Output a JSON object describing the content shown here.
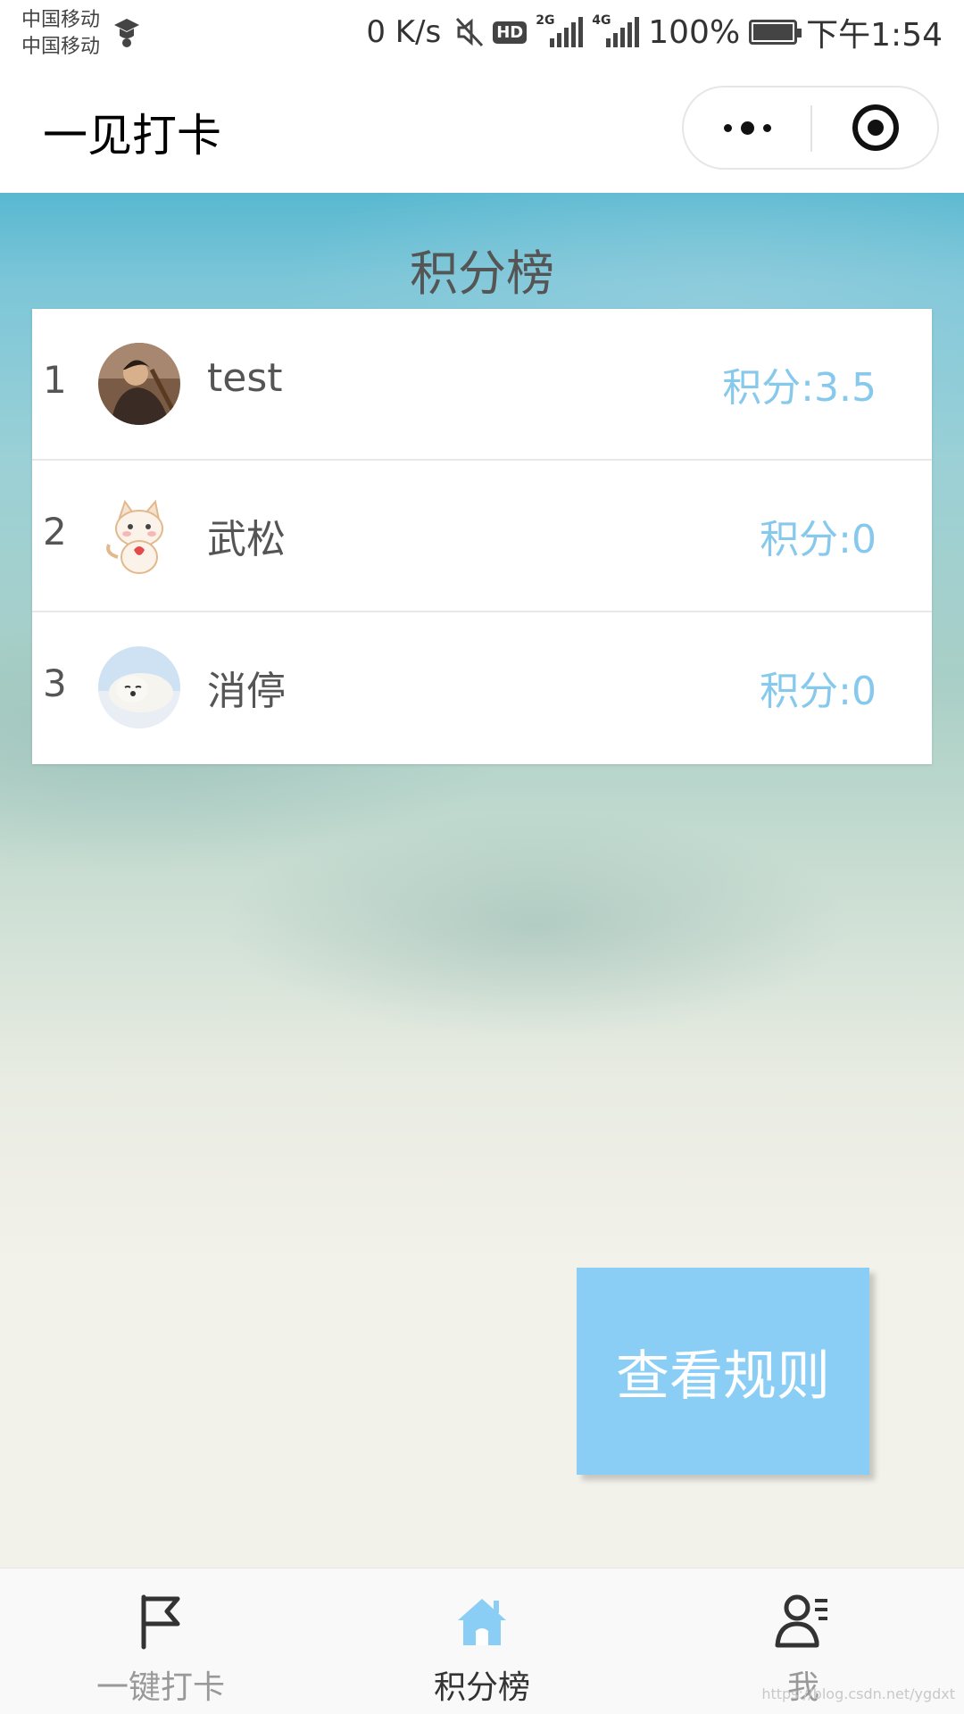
{
  "status_bar": {
    "carrier_1": "中国移动",
    "carrier_2": "中国移动",
    "net_speed": "0 K/s",
    "hd": "HD",
    "sim1_gen": "2G",
    "sim2_gen": "4G",
    "battery": "100%",
    "time": "下午1:54"
  },
  "nav_bar": {
    "title": "一见打卡",
    "more_icon": "more-dots-icon",
    "close_icon": "target-circle-icon"
  },
  "board": {
    "title": "积分榜",
    "entries": [
      {
        "rank": "1",
        "name": "test",
        "score": "积分:3.5",
        "avatar": "portrait-avatar"
      },
      {
        "rank": "2",
        "name": "武松",
        "score": "积分:0",
        "avatar": "cat-avatar"
      },
      {
        "rank": "3",
        "name": "消停",
        "score": "积分:0",
        "avatar": "seal-avatar"
      }
    ]
  },
  "rules_button": {
    "label": "查看规则"
  },
  "tab_bar": {
    "tabs": [
      {
        "label": "一键打卡",
        "icon": "flag-icon",
        "active": false
      },
      {
        "label": "积分榜",
        "icon": "home-icon",
        "active": true
      },
      {
        "label": "我",
        "icon": "user-profile-icon",
        "active": false
      }
    ]
  },
  "watermark": "https://blog.csdn.net/ygdxt",
  "colors": {
    "accent": "#86c9ec",
    "button": "#8acef6",
    "active_tab_icon": "#8acef6"
  }
}
